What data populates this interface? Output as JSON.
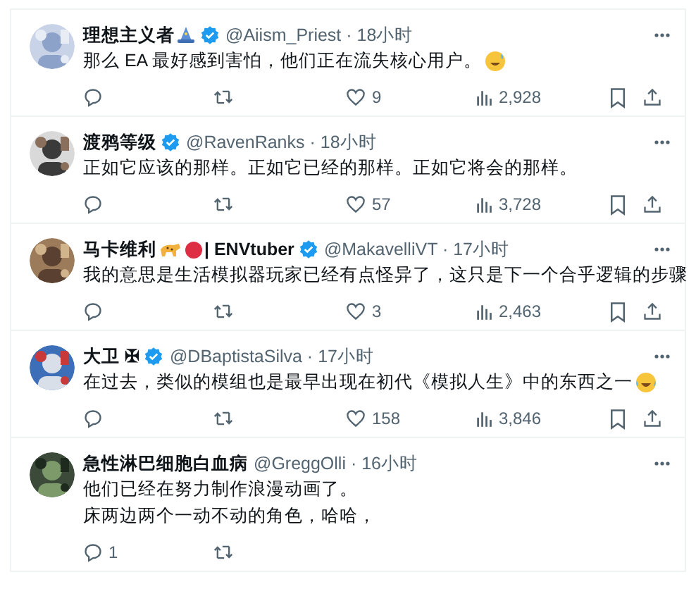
{
  "tweets": [
    {
      "avatar": {
        "kind": "picture"
      },
      "name_parts": [
        {
          "kind": "text",
          "text": "理想主义者"
        },
        {
          "kind": "wizard"
        }
      ],
      "verified": true,
      "meta": "@Aiism_Priest · 18小时",
      "body": [
        [
          {
            "kind": "text",
            "text": "那么 EA 最好感到害怕，他们正在流失核心用户。"
          },
          {
            "kind": "sweat"
          }
        ]
      ],
      "actions": [
        {
          "kind": "reply"
        },
        {
          "kind": "retweet"
        },
        {
          "kind": "like",
          "count": "9"
        },
        {
          "kind": "views",
          "count": "2,928"
        },
        {
          "kind": "bookmark"
        },
        {
          "kind": "share"
        }
      ]
    },
    {
      "avatar": {
        "kind": "picture"
      },
      "name_parts": [
        {
          "kind": "text",
          "text": "渡鸦等级"
        }
      ],
      "verified": true,
      "meta": "@RavenRanks · 18小时",
      "body": [
        [
          {
            "kind": "text",
            "text": "正如它应该的那样。正如它已经的那样。正如它将会的那样。"
          }
        ]
      ],
      "actions": [
        {
          "kind": "reply"
        },
        {
          "kind": "retweet"
        },
        {
          "kind": "like",
          "count": "57"
        },
        {
          "kind": "views",
          "count": "3,728"
        },
        {
          "kind": "bookmark"
        },
        {
          "kind": "share"
        }
      ]
    },
    {
      "avatar": {
        "kind": "picture"
      },
      "name_parts": [
        {
          "kind": "text",
          "text": "马卡维利"
        },
        {
          "kind": "leopard"
        },
        {
          "kind": "red-dot"
        },
        {
          "kind": "text",
          "text": "| ENVtuber"
        }
      ],
      "verified": true,
      "meta": "@MakavelliVT · 17小时",
      "body": [
        [
          {
            "kind": "text",
            "text": "我的意思是生活模拟器玩家已经有点怪异了，这只是下一个合乎逻辑的步骤"
          }
        ]
      ],
      "actions": [
        {
          "kind": "reply"
        },
        {
          "kind": "retweet"
        },
        {
          "kind": "like",
          "count": "3"
        },
        {
          "kind": "views",
          "count": "2,463"
        },
        {
          "kind": "bookmark"
        },
        {
          "kind": "share"
        }
      ]
    },
    {
      "avatar": {
        "kind": "picture"
      },
      "name_parts": [
        {
          "kind": "text",
          "text": "大卫 ✠"
        }
      ],
      "verified": true,
      "meta": "@DBaptistaSilva · 17小时",
      "body": [
        [
          {
            "kind": "text",
            "text": "在过去，类似的模组也是最早出现在初代《模拟人生》中的东西之一"
          },
          {
            "kind": "laugh"
          }
        ]
      ],
      "actions": [
        {
          "kind": "reply"
        },
        {
          "kind": "retweet"
        },
        {
          "kind": "like",
          "count": "158"
        },
        {
          "kind": "views",
          "count": "3,846"
        },
        {
          "kind": "bookmark"
        },
        {
          "kind": "share"
        }
      ]
    },
    {
      "avatar": {
        "kind": "picture"
      },
      "name_parts": [
        {
          "kind": "text",
          "text": "急性淋巴细胞白血病"
        }
      ],
      "verified": false,
      "meta": "@GreggOlli · 16小时",
      "body": [
        [
          {
            "kind": "text",
            "text": "他们已经在努力制作浪漫动画了。"
          }
        ],
        [
          {
            "kind": "text",
            "text": "床两边两个一动不动的角色，哈哈，"
          }
        ]
      ],
      "actions": [
        {
          "kind": "reply",
          "count": "1"
        },
        {
          "kind": "retweet"
        }
      ]
    }
  ]
}
